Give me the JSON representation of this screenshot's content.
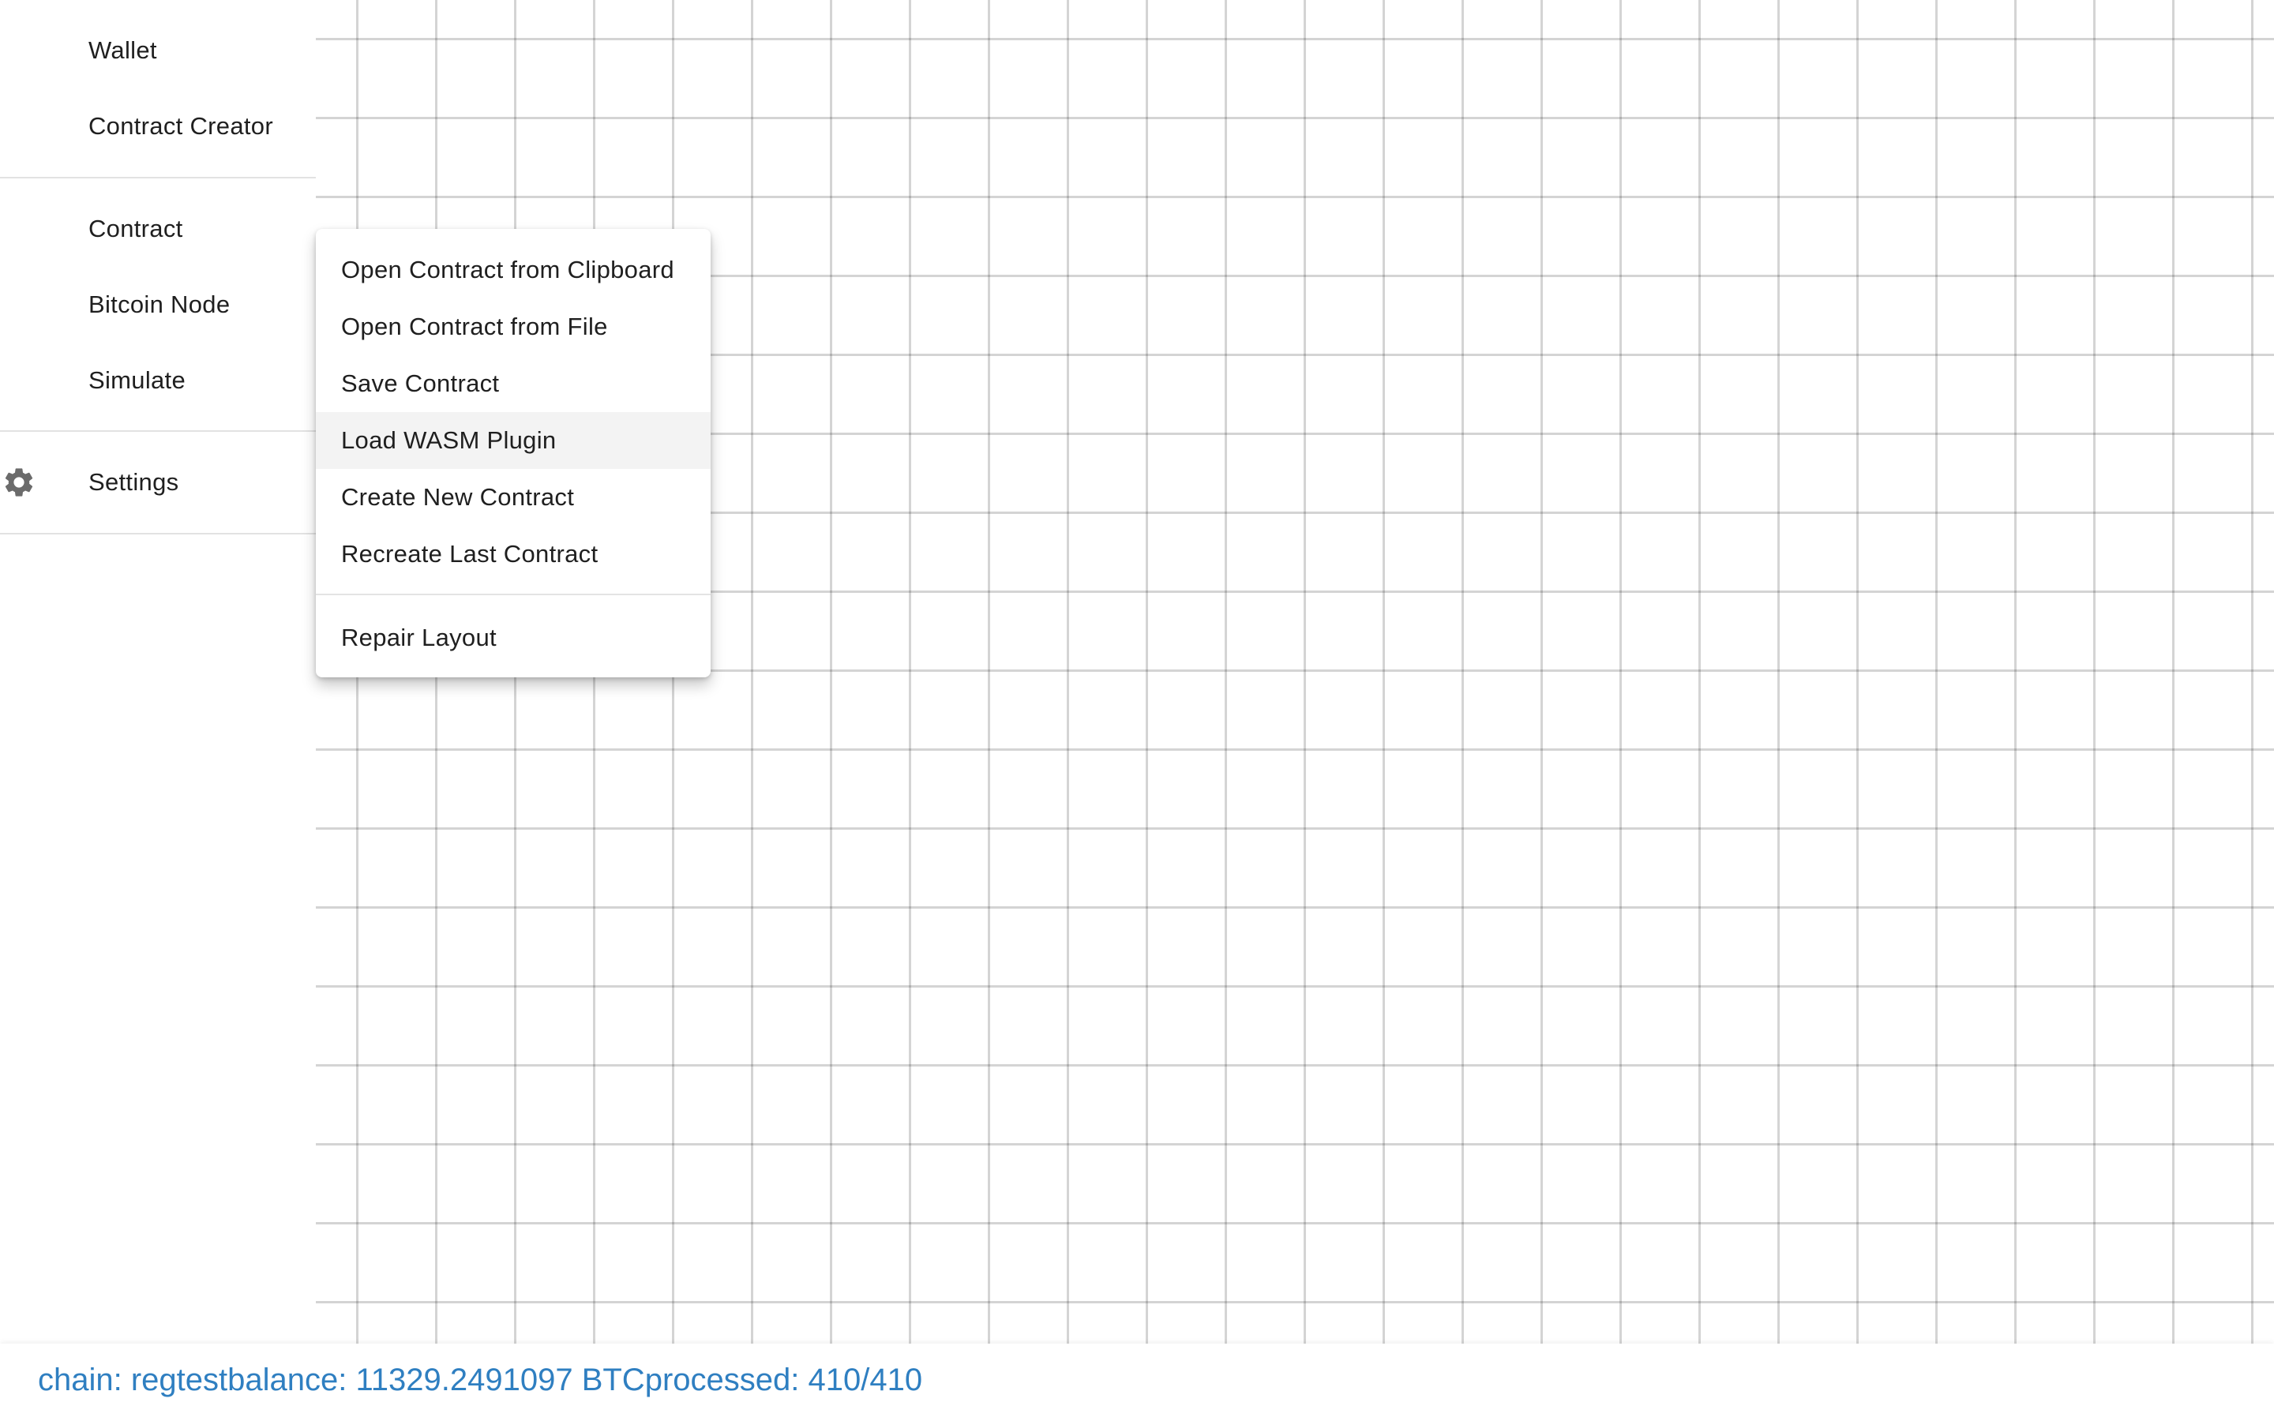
{
  "sidebar": {
    "items": [
      {
        "label": "Wallet"
      },
      {
        "label": "Contract Creator"
      },
      {
        "label": "Contract"
      },
      {
        "label": "Bitcoin Node"
      },
      {
        "label": "Simulate"
      },
      {
        "label": "Settings",
        "icon": "gear-icon"
      }
    ]
  },
  "context_menu": {
    "items": [
      {
        "label": "Open Contract from Clipboard"
      },
      {
        "label": "Open Contract from File"
      },
      {
        "label": "Save Contract"
      },
      {
        "label": "Load WASM Plugin",
        "highlighted": true
      },
      {
        "label": "Create New Contract"
      },
      {
        "label": "Recreate Last Contract"
      },
      {
        "label": "Repair Layout"
      }
    ]
  },
  "status": {
    "chain": "chain: regtest",
    "balance": "balance: 11329.2491097 BTC",
    "processed": "processed: 410/410"
  },
  "colors": {
    "status_text": "#2f7fc1",
    "menu_highlight": "#f3f3f3",
    "grid_line": "#d6d6d6"
  }
}
